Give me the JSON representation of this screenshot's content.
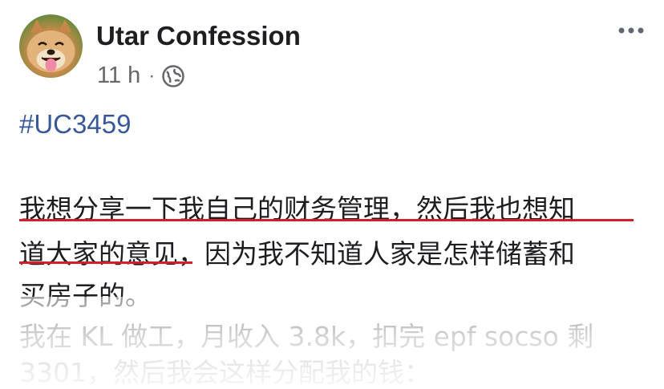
{
  "header": {
    "page_name": "Utar Confession",
    "time": "11 h",
    "separator": "·",
    "privacy_icon": "globe-icon",
    "more_icon": "more-dots-icon"
  },
  "post": {
    "hashtag": "#UC3459",
    "lines": [
      "我想分享一下我自己的财务管理，然后我也想知",
      "道大家的意见，因为我不知道人家是怎样储蓄和",
      "买房子的。",
      "我在 KL 做工，月收入 3.8k，扣完 epf socso 剩",
      "3301，然后我会这样分配我的钱："
    ]
  },
  "colors": {
    "title": "#1c1e21",
    "meta": "#65676b",
    "hashtag": "#385898",
    "underline": "#d0202a"
  }
}
